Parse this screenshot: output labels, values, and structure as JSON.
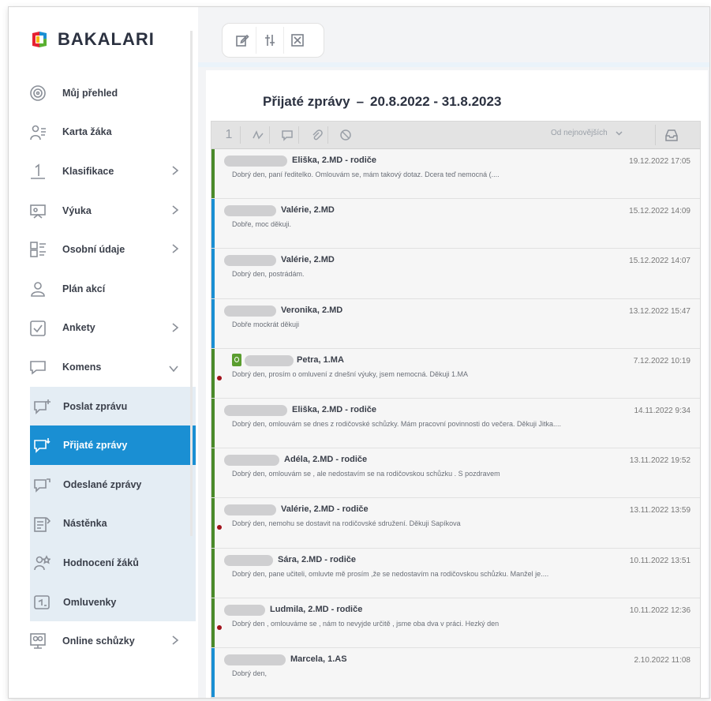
{
  "app": {
    "brand": "BAKALARI",
    "brand_colors": [
      "#e62231",
      "#1a8fd3",
      "#5ab031",
      "#f5b90b"
    ]
  },
  "sidebar": {
    "items": [
      {
        "label": "Můj přehled",
        "icon": "dashboard-icon",
        "chevron": false
      },
      {
        "label": "Karta žáka",
        "icon": "student-card-icon",
        "chevron": false
      },
      {
        "label": "Klasifikace",
        "icon": "grade-icon",
        "chevron": true
      },
      {
        "label": "Výuka",
        "icon": "teaching-icon",
        "chevron": true
      },
      {
        "label": "Osobní údaje",
        "icon": "personal-data-icon",
        "chevron": true
      },
      {
        "label": "Plán akcí",
        "icon": "event-plan-icon",
        "chevron": false
      },
      {
        "label": "Ankety",
        "icon": "survey-icon",
        "chevron": true
      },
      {
        "label": "Komens",
        "icon": "comments-icon",
        "chevron": "down"
      }
    ],
    "sub_items": [
      {
        "label": "Poslat zprávu",
        "icon": "send-message-icon"
      },
      {
        "label": "Přijaté zprávy",
        "icon": "received-messages-icon",
        "active": true
      },
      {
        "label": "Odeslané zprávy",
        "icon": "sent-messages-icon"
      },
      {
        "label": "Nástěnka",
        "icon": "noticeboard-icon"
      },
      {
        "label": "Hodnocení žáků",
        "icon": "student-rating-icon"
      },
      {
        "label": "Omluvenky",
        "icon": "excuses-icon"
      }
    ],
    "after_items": [
      {
        "label": "Online schůzky",
        "icon": "online-meeting-icon",
        "chevron": true
      }
    ]
  },
  "main": {
    "title": "Přijaté zprávy",
    "dash": "–",
    "period": "20.8.2022 - 31.8.2023",
    "list_head": {
      "first_icon": "1",
      "sort_label": "Od nejnovějších"
    },
    "messages": [
      {
        "sender": "Eliška, 2.MD - rodiče",
        "date": "19.12.2022 17:05",
        "preview": "Dobrý den, paní ředitelko. Omlouvám se, mám takový dotaz. Dcera teď nemocná (....",
        "bar": "#4a8a2a",
        "unread": false,
        "badge": false
      },
      {
        "sender": "Valérie, 2.MD",
        "date": "15.12.2022 14:09",
        "preview": "Dobře, moc děkuji.",
        "bar": "#1a8fd3",
        "unread": false,
        "badge": false
      },
      {
        "sender": "Valérie, 2.MD",
        "date": "15.12.2022 14:07",
        "preview": "Dobrý den, postrádám.",
        "bar": "#1a8fd3",
        "unread": false,
        "badge": false
      },
      {
        "sender": "Veronika, 2.MD",
        "date": "13.12.2022 15:47",
        "preview": "Dobře mockrát děkuji",
        "bar": "#1a8fd3",
        "unread": false,
        "badge": false
      },
      {
        "sender": "Petra, 1.MA",
        "date": "7.12.2022 10:19",
        "preview": "Dobrý den, prosím o omluvení z dnešní výuky, jsem nemocná. Děkuji 1.MA",
        "bar": "#4a8a2a",
        "unread": true,
        "badge": true
      },
      {
        "sender": "Eliška, 2.MD - rodiče",
        "date": "14.11.2022 9:34",
        "preview": "Dobrý den, omlouvám se dnes z rodičovské schůzky. Mám pracovní povinnosti do večera. Děkuji Jitka....",
        "bar": "#4a8a2a",
        "unread": false,
        "badge": false
      },
      {
        "sender": "Adéla, 2.MD - rodiče",
        "date": "13.11.2022 19:52",
        "preview": "Dobrý den, omlouvám se , ale nedostavím se na rodičovskou schůzku . S pozdravem",
        "bar": "#4a8a2a",
        "unread": false,
        "badge": false
      },
      {
        "sender": "Valérie, 2.MD - rodiče",
        "date": "13.11.2022 13:59",
        "preview": "Dobrý den, nemohu se dostavit na rodičovské sdružení. Děkuji Sapíkova",
        "bar": "#4a8a2a",
        "unread": true,
        "badge": false
      },
      {
        "sender": "Sára, 2.MD - rodiče",
        "date": "10.11.2022 13:51",
        "preview": "Dobrý den, pane učiteli, omluvte mě prosím ,že se nedostavím na rodičovskou schůzku. Manžel je....",
        "bar": "#4a8a2a",
        "unread": false,
        "badge": false
      },
      {
        "sender": "Ludmila, 2.MD - rodiče",
        "date": "10.11.2022 12:36",
        "preview": "Dobrý den , omlouváme se , nám to nevyjde určitě , jsme oba dva v práci. Hezký den",
        "bar": "#4a8a2a",
        "unread": true,
        "badge": false
      },
      {
        "sender": "Marcela, 1.AS",
        "date": "2.10.2022 11:08",
        "preview": "Dobrý den,",
        "bar": "#1a8fd3",
        "unread": false,
        "badge": false
      }
    ]
  }
}
